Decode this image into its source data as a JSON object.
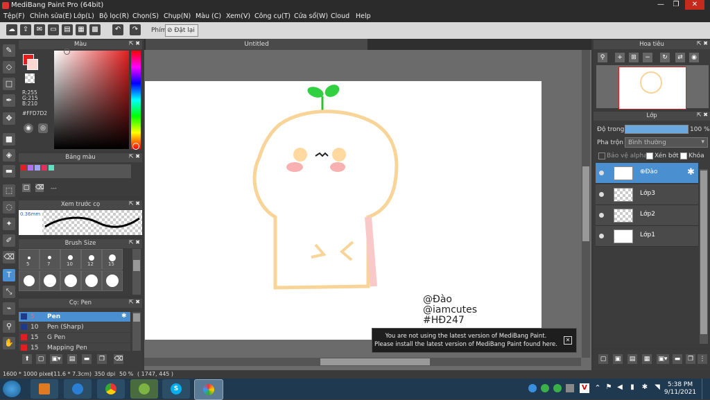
{
  "app": {
    "title": "MediBang Paint Pro (64bit)"
  },
  "menu": [
    "Tệp(F)",
    "Chỉnh sửa(E)",
    "Lớp(L)",
    "Bộ lọc(R)",
    "Chọn(S)",
    "Chụp(N)",
    "Màu (C)",
    "Xem(V)",
    "Công cụ(T)",
    "Cửa sổ(W)",
    "Cloud",
    "Help"
  ],
  "toolbar": {
    "label": "Phím",
    "reset": "Đặt lại"
  },
  "color_panel": {
    "title": "Màu",
    "r": "R:255",
    "g": "G:215",
    "b": "B:210",
    "hex": "#FFD7D2"
  },
  "palette_panel": {
    "title": "Bảng màu",
    "dash": "---"
  },
  "brush_preview": {
    "title": "Xem trước cọ",
    "size": "0.36mm"
  },
  "brush_size": {
    "title": "Brush Size",
    "sizes": [
      "5",
      "7",
      "10",
      "12",
      "15"
    ]
  },
  "brush_list": {
    "title": "Cọ: Pen",
    "items": [
      {
        "size": "5",
        "name": "Pen",
        "color": "#1e3a8a"
      },
      {
        "size": "10",
        "name": "Pen (Sharp)",
        "color": "#1e3a8a"
      },
      {
        "size": "15",
        "name": "G Pen",
        "color": "#e02020"
      },
      {
        "size": "15",
        "name": "Mapping Pen",
        "color": "#e02020"
      }
    ]
  },
  "document": {
    "tab": "Untitled"
  },
  "canvas_text": {
    "line1": "@Đào",
    "line2": "@iamcutes",
    "line3": "#HĐ247"
  },
  "notice": {
    "line1": "You are not using the latest version of MediBang Paint.",
    "line2": "Please install the latest version of MediBang Paint found here."
  },
  "navigator": {
    "title": "Hoa tiêu"
  },
  "layers_panel": {
    "title": "Lớp",
    "opacity_label": "Độ trong",
    "opacity_value": "100 %",
    "blend_label": "Pha trộn",
    "blend_value": "Bình thường",
    "protect_alpha": "Bảo vệ alpha",
    "clip": "Xén bớt",
    "lock": "Khóa",
    "layers": [
      {
        "name": "⊕Đào",
        "selected": true
      },
      {
        "name": "Lớp3"
      },
      {
        "name": "Lớp2"
      },
      {
        "name": "Lớp1"
      }
    ]
  },
  "status": {
    "size": "1600 * 1000 pixel",
    "cm": "(11.6 * 7.3cm)",
    "dpi": "350 dpi",
    "zoom": "50 %",
    "coords": "( 1747, 445 )"
  },
  "clock": {
    "time": "5:38 PM",
    "date": "9/11/2021"
  }
}
